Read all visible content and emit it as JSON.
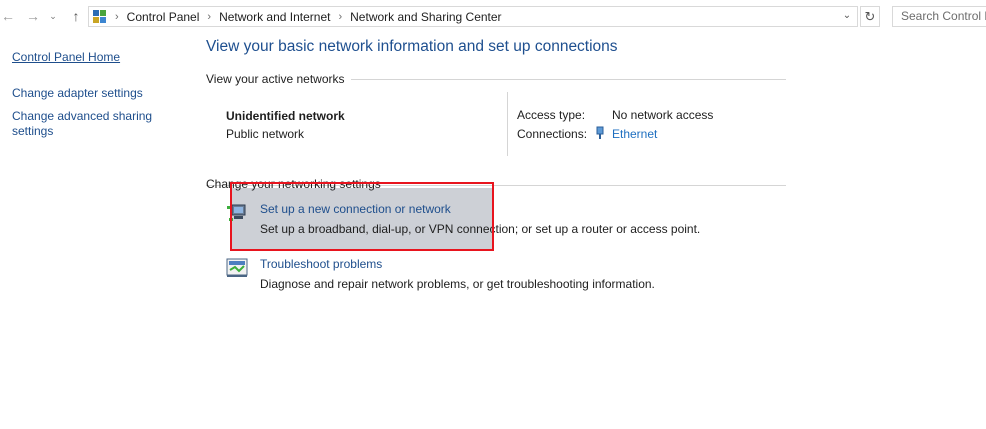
{
  "nav": {
    "back_icon": "back-arrow-icon",
    "forward_icon": "forward-arrow-icon",
    "up_icon": "up-arrow-icon"
  },
  "address": {
    "icon": "control-panel-icon",
    "crumbs": [
      "Control Panel",
      "Network and Internet",
      "Network and Sharing Center"
    ],
    "dropdown_icon": "chevron-down-icon",
    "refresh_icon": "refresh-icon"
  },
  "search": {
    "placeholder": "Search Control P"
  },
  "sidebar": {
    "items": [
      {
        "label": "Control Panel Home"
      },
      {
        "label": "Change adapter settings"
      },
      {
        "label": "Change advanced sharing"
      },
      {
        "label": "settings"
      }
    ]
  },
  "main": {
    "title": "View your basic network information and set up connections",
    "active_section": "View your active networks",
    "network_name": "Unidentified network",
    "network_type": "Public network",
    "access_type_label": "Access type:",
    "access_type_value": "No network access",
    "connections_label": "Connections:",
    "connections_value": "Ethernet",
    "change_section": "Change your networking settings",
    "tasks": [
      {
        "link": "Set up a new connection or network",
        "desc": "Set up a broadband, dial-up, or VPN connection; or set up a router or access point."
      },
      {
        "link": "Troubleshoot problems",
        "desc": "Diagnose and repair network problems, or get troubleshooting information."
      }
    ]
  },
  "colors": {
    "link": "#1e4e8c",
    "highlight": "#cdd0d6",
    "annotation_box": "#e8141e"
  }
}
